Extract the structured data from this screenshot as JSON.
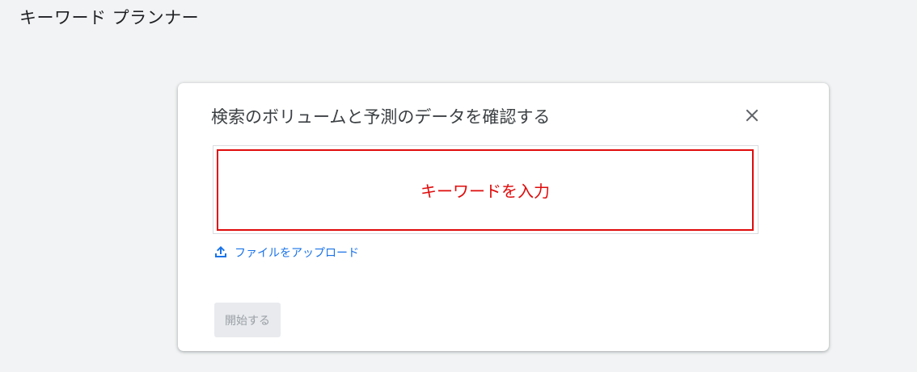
{
  "page": {
    "title": "キーワード プランナー"
  },
  "dialog": {
    "title": "検索のボリュームと予測のデータを確認する",
    "close_icon": "close-icon",
    "keyword_placeholder": "キーワードを入力",
    "upload_icon": "upload-icon",
    "upload_label": "ファイルをアップロード",
    "start_label": "開始する",
    "start_disabled": true
  },
  "colors": {
    "background": "#f1f3f4",
    "highlight": "#e00b0b",
    "link": "#1a73e8",
    "disabled_text": "#9aa0a6"
  }
}
